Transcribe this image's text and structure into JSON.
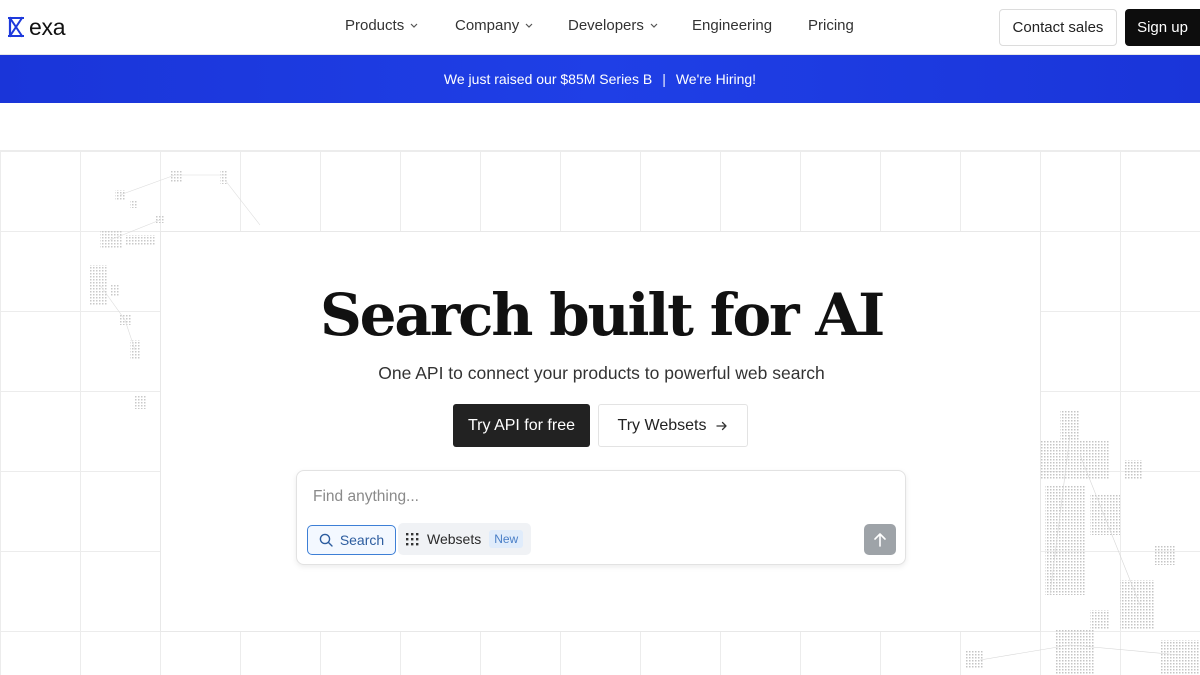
{
  "brand": {
    "name": "exa",
    "icon": "exa-logo-icon"
  },
  "nav": {
    "items": [
      {
        "label": "Products",
        "dropdown": true
      },
      {
        "label": "Company",
        "dropdown": true
      },
      {
        "label": "Developers",
        "dropdown": true
      },
      {
        "label": "Engineering",
        "dropdown": false
      },
      {
        "label": "Pricing",
        "dropdown": false
      }
    ],
    "contact_label": "Contact sales",
    "signup_label": "Sign up"
  },
  "banner": {
    "announcement": "We just raised our $85M Series B",
    "separator": "|",
    "hiring": "We're Hiring!",
    "color": "#1f3fe6"
  },
  "hero": {
    "title": "Search built for AI",
    "subtitle": "One API to connect your products to powerful web search",
    "primary_cta": "Try API for free",
    "secondary_cta": "Try Websets",
    "secondary_icon": "arrow-right-icon"
  },
  "search": {
    "placeholder": "Find anything...",
    "value": "",
    "modes": [
      {
        "label": "Search",
        "icon": "search-icon",
        "selected": true
      },
      {
        "label": "Websets",
        "icon": "grid-dots-icon",
        "selected": false,
        "badge": "New"
      }
    ],
    "submit_icon": "arrow-up-icon"
  }
}
